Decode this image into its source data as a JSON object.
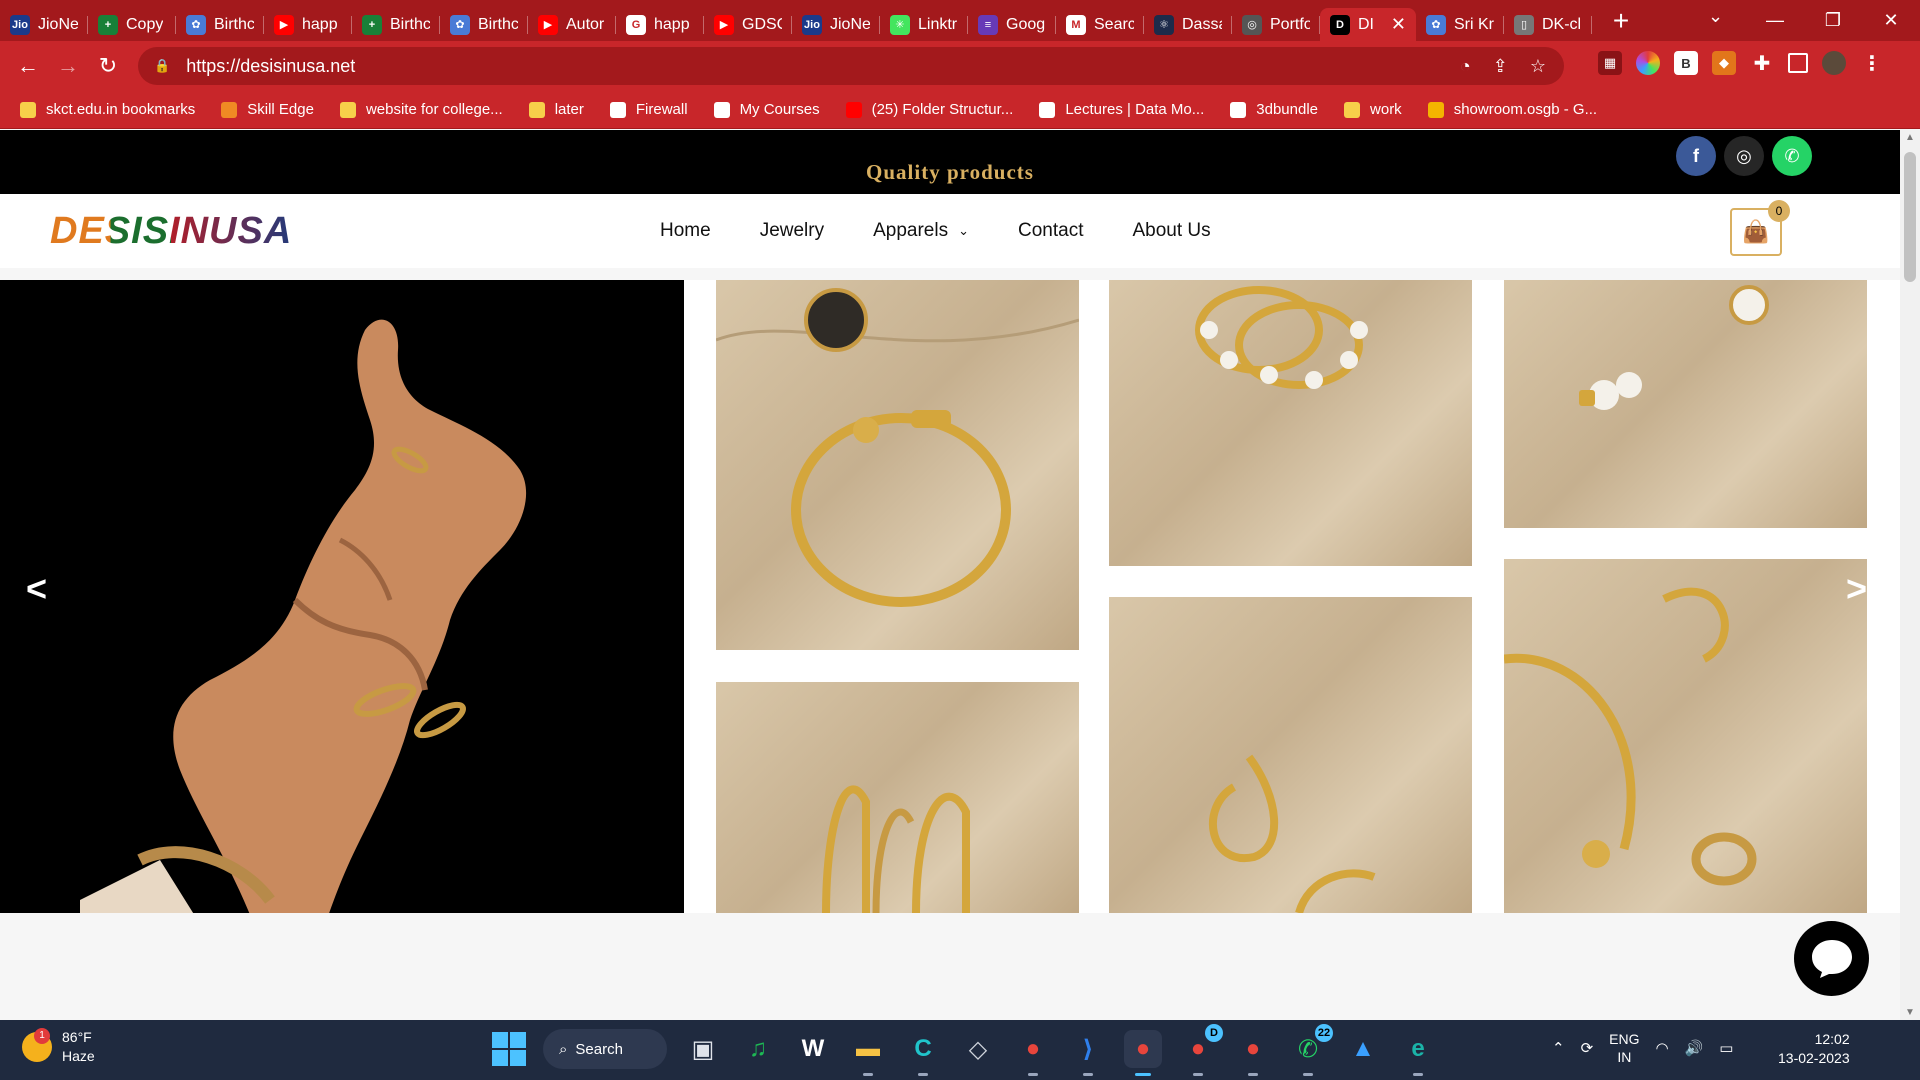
{
  "browser": {
    "tabs": [
      {
        "label": "JioNe",
        "icon": "jio-icon",
        "color": "#1b3a8a",
        "glyph": "Jio"
      },
      {
        "label": "Copy",
        "icon": "sheets-icon",
        "color": "#188038",
        "glyph": "+"
      },
      {
        "label": "Birthc",
        "icon": "birthday-icon",
        "color": "#4a7bd6",
        "glyph": "✿"
      },
      {
        "label": "happ",
        "icon": "youtube-icon",
        "color": "#ff0000",
        "glyph": "▶"
      },
      {
        "label": "Birthc",
        "icon": "sheets-icon",
        "color": "#188038",
        "glyph": "+"
      },
      {
        "label": "Birthc",
        "icon": "birthday-icon",
        "color": "#4a7bd6",
        "glyph": "✿"
      },
      {
        "label": "Autor",
        "icon": "youtube-icon",
        "color": "#ff0000",
        "glyph": "▶"
      },
      {
        "label": "happ",
        "icon": "google-icon",
        "color": "#ffffff",
        "glyph": "G"
      },
      {
        "label": "GDSC",
        "icon": "youtube-icon",
        "color": "#ff0000",
        "glyph": "▶"
      },
      {
        "label": "JioNe",
        "icon": "jio-icon",
        "color": "#1b3a8a",
        "glyph": "Jio"
      },
      {
        "label": "Linktr",
        "icon": "linktree-icon",
        "color": "#43e55e",
        "glyph": "✳"
      },
      {
        "label": "Goog",
        "icon": "forms-icon",
        "color": "#673ab7",
        "glyph": "≡"
      },
      {
        "label": "Searc",
        "icon": "gmail-icon",
        "color": "#ffffff",
        "glyph": "M"
      },
      {
        "label": "Dassa",
        "icon": "react-icon",
        "color": "#1d2b4a",
        "glyph": "⚛"
      },
      {
        "label": "Portfo",
        "icon": "portfolio-icon",
        "color": "#555555",
        "glyph": "◎"
      },
      {
        "label": "DI",
        "icon": "desisinusa-icon",
        "color": "#000000",
        "glyph": "D",
        "active": true
      },
      {
        "label": "Sri Kr",
        "icon": "flutter-icon",
        "color": "#4a7bd6",
        "glyph": "✿"
      },
      {
        "label": "DK-cl",
        "icon": "file-icon",
        "color": "#777777",
        "glyph": "▯"
      }
    ],
    "url": "https://desisinusa.net",
    "bookmarks": [
      {
        "label": "skct.edu.in bookmarks",
        "icon": "folder-icon",
        "color": "#f7cf4a"
      },
      {
        "label": "Skill Edge",
        "icon": "skilledge-icon",
        "color": "#f08a24"
      },
      {
        "label": "website for college...",
        "icon": "folder-icon",
        "color": "#f7cf4a"
      },
      {
        "label": "later",
        "icon": "folder-icon",
        "color": "#f7cf4a"
      },
      {
        "label": "Firewall",
        "icon": "globe-icon",
        "color": "#ffffff"
      },
      {
        "label": "My Courses",
        "icon": "globe-icon",
        "color": "#ffffff"
      },
      {
        "label": "(25) Folder Structur...",
        "icon": "youtube-icon",
        "color": "#ff0000"
      },
      {
        "label": "Lectures | Data Mo...",
        "icon": "edx-icon",
        "color": "#ffffff"
      },
      {
        "label": "3dbundle",
        "icon": "globe-icon",
        "color": "#ffffff"
      },
      {
        "label": "work",
        "icon": "folder-icon",
        "color": "#f7cf4a"
      },
      {
        "label": "showroom.osgb - G...",
        "icon": "drive-icon",
        "color": "#f4b400"
      }
    ]
  },
  "site": {
    "tagline": "Quality products",
    "logo": "DESISINUSA",
    "nav": [
      {
        "label": "Home"
      },
      {
        "label": "Jewelry"
      },
      {
        "label": "Apparels",
        "dropdown": true
      },
      {
        "label": "Contact"
      },
      {
        "label": "About Us"
      }
    ],
    "cart_count": "0",
    "social": [
      {
        "name": "facebook-icon",
        "color": "#3b5998",
        "glyph": "f"
      },
      {
        "name": "instagram-icon",
        "color": "#262626",
        "glyph": "◎"
      },
      {
        "name": "whatsapp-icon",
        "color": "#25d366",
        "glyph": "✆"
      }
    ],
    "accent_color": "#d9b061"
  },
  "taskbar": {
    "weather_temp": "86°F",
    "weather_desc": "Haze",
    "weather_badge": "1",
    "search_label": "Search",
    "apps": [
      {
        "name": "task-view-icon",
        "color": "#dfe3ea",
        "glyph": "▣",
        "running": false
      },
      {
        "name": "spotify-icon",
        "color": "#1db954",
        "glyph": "♫",
        "running": false
      },
      {
        "name": "app-w-icon",
        "color": "#ffffff",
        "glyph": "W",
        "running": false
      },
      {
        "name": "file-explorer-icon",
        "color": "#f6c244",
        "glyph": "▬",
        "running": true
      },
      {
        "name": "canva-icon",
        "color": "#20c4cb",
        "glyph": "C",
        "running": true
      },
      {
        "name": "unity-icon",
        "color": "#cfd4dc",
        "glyph": "◇",
        "running": false
      },
      {
        "name": "chrome-icon",
        "color": "#e8453c",
        "glyph": "●",
        "running": true
      },
      {
        "name": "vscode-icon",
        "color": "#2f80ed",
        "glyph": "⟩",
        "running": true
      },
      {
        "name": "chrome-profile-icon",
        "color": "#e8453c",
        "glyph": "●",
        "running": true,
        "active": true
      },
      {
        "name": "chrome-icon",
        "color": "#e8453c",
        "glyph": "●",
        "running": true,
        "badge": "D"
      },
      {
        "name": "chrome-icon",
        "color": "#e8453c",
        "glyph": "●",
        "running": true
      },
      {
        "name": "whatsapp-icon",
        "color": "#25d366",
        "glyph": "✆",
        "running": true,
        "badge": "22"
      },
      {
        "name": "photos-icon",
        "color": "#3aa0ff",
        "glyph": "▲",
        "running": false
      },
      {
        "name": "edge-icon",
        "color": "#1bb3a8",
        "glyph": "e",
        "running": true
      }
    ],
    "lang_line1": "ENG",
    "lang_line2": "IN",
    "time": "12:02",
    "date": "13-02-2023"
  }
}
